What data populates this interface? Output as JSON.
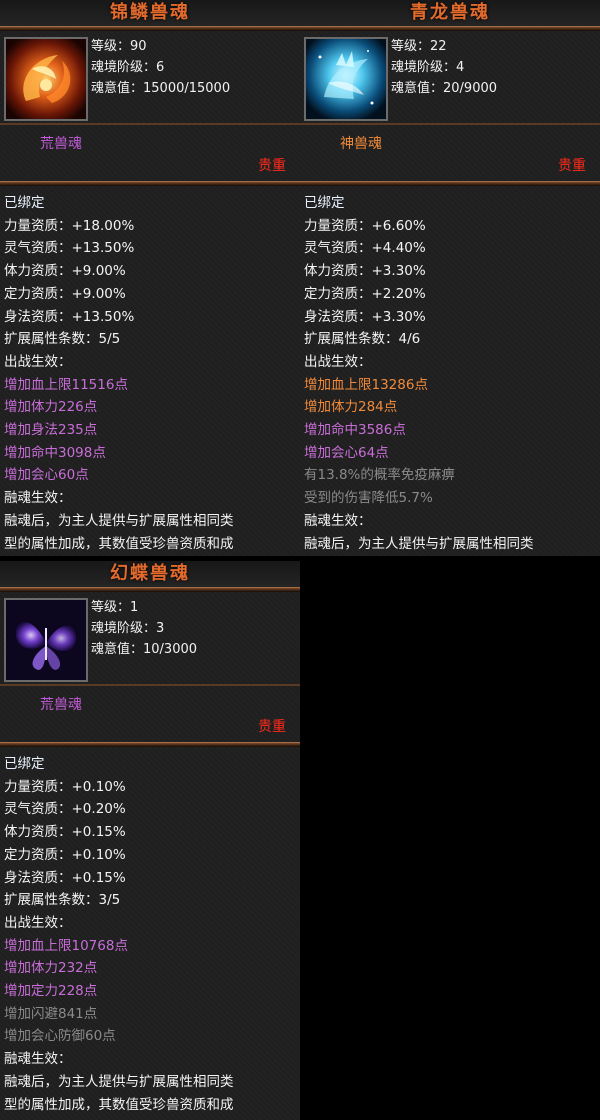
{
  "cards": [
    {
      "title": "锦鳞兽魂",
      "portrait_icon": "fire-koi-spirit-icon",
      "level": "等级：90",
      "tier": "魂境阶级：6",
      "soul": "魂意值：15000/15000",
      "type": "荒兽魂",
      "rarity": "贵重",
      "bound": "已绑定",
      "attrs": [
        "力量资质：+18.00%",
        "灵气资质：+13.50%",
        "体力资质：+9.00%",
        "定力资质：+9.00%",
        "身法资质：+13.50%"
      ],
      "ext_count": "扩展属性条数：5/5",
      "battle_label": "出战生效：",
      "effects": [
        "增加血上限11516点",
        "增加体力226点",
        "增加身法235点",
        "增加命中3098点",
        "增加会心60点"
      ],
      "fuse_label": "融魂生效：",
      "fuse_lines": [
        "融魂后，为主人提供与扩展属性相同类",
        "型的属性加成，其数值受珍兽资质和成"
      ]
    },
    {
      "title": "青龙兽魂",
      "portrait_icon": "azure-dragon-spirit-icon",
      "level": "等级：22",
      "tier": "魂境阶级：4",
      "soul": "魂意值：20/9000",
      "type": "神兽魂",
      "rarity": "贵重",
      "bound": "已绑定",
      "attrs": [
        "力量资质：+6.60%",
        "灵气资质：+4.40%",
        "体力资质：+3.30%",
        "定力资质：+2.20%",
        "身法资质：+3.30%"
      ],
      "ext_count": "扩展属性条数：4/6",
      "battle_label": "出战生效：",
      "effects": [
        "增加血上限13286点",
        "增加体力284点",
        "增加命中3586点",
        "增加会心64点"
      ],
      "special": [
        "有13.8%的概率免疫麻痹",
        "受到的伤害降低5.7%"
      ],
      "fuse_label": "融魂生效：",
      "fuse_lines": [
        "融魂后，为主人提供与扩展属性相同类"
      ]
    },
    {
      "title": "幻蝶兽魂",
      "portrait_icon": "phantom-butterfly-spirit-icon",
      "level": "等级：1",
      "tier": "魂境阶级：3",
      "soul": "魂意值：10/3000",
      "type": "荒兽魂",
      "rarity": "贵重",
      "bound": "已绑定",
      "attrs": [
        "力量资质：+0.10%",
        "灵气资质：+0.20%",
        "体力资质：+0.15%",
        "定力资质：+0.10%",
        "身法资质：+0.15%"
      ],
      "ext_count": "扩展属性条数：3/5",
      "battle_label": "出战生效：",
      "effects": [
        "增加血上限10768点",
        "增加体力232点",
        "增加定力228点"
      ],
      "inactive_effects": [
        "增加闪避841点",
        "增加会心防御60点"
      ],
      "fuse_label": "融魂生效：",
      "fuse_lines": [
        "融魂后，为主人提供与扩展属性相同类",
        "型的属性加成，其数值受珍兽资质和成"
      ]
    }
  ]
}
